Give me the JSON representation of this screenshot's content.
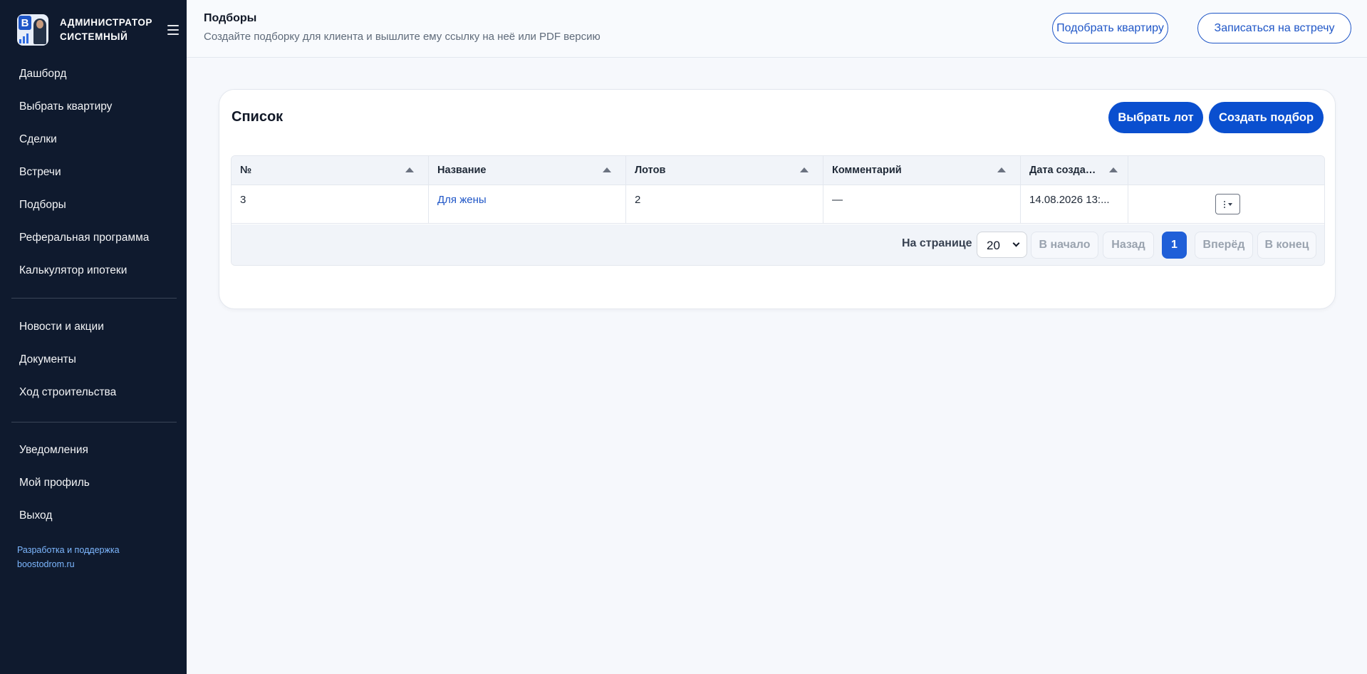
{
  "brand": {
    "line1": "Администратор",
    "line2": "системный"
  },
  "sidebar": {
    "main": [
      {
        "label": "Дашборд"
      },
      {
        "label": "Выбрать квартиру"
      },
      {
        "label": "Сделки"
      },
      {
        "label": "Встречи"
      },
      {
        "label": "Подборы"
      },
      {
        "label": "Реферальная программа"
      },
      {
        "label": "Калькулятор ипотеки"
      }
    ],
    "info": [
      {
        "label": "Новости и акции"
      },
      {
        "label": "Документы"
      },
      {
        "label": "Ход строительства"
      }
    ],
    "account": [
      {
        "label": "Уведомления"
      },
      {
        "label": "Мой профиль"
      },
      {
        "label": "Выход"
      }
    ],
    "credits": {
      "line1": "Разработка и поддержка",
      "line2": "boostodrom.ru"
    }
  },
  "header": {
    "title": "Подборы",
    "subtitle": "Создайте подборку для клиента и вышлите ему ссылку на неё или PDF версию",
    "btn_pick_apartment": "Подобрать квартиру",
    "btn_book_meeting": "Записаться на встречу"
  },
  "card": {
    "title": "Список",
    "btn_choose_lot": "Выбрать лот",
    "btn_create_selection": "Создать подбор"
  },
  "table": {
    "columns": [
      "№",
      "Название",
      "Лотов",
      "Комментарий",
      "Дата создания"
    ],
    "rows": [
      {
        "num": "3",
        "name": "Для жены",
        "lots": "2",
        "comment": "—",
        "date": "14.08.2026 13:..."
      }
    ]
  },
  "pagination": {
    "per_page_label": "На странице",
    "per_page_value": "20",
    "first": "В начало",
    "prev": "Назад",
    "current": "1",
    "next": "Вперёд",
    "last": "В конец"
  },
  "colors": {
    "sidebar_bg": "#0f1a2e",
    "accent": "#0a4fcf",
    "link": "#1f56c7"
  }
}
